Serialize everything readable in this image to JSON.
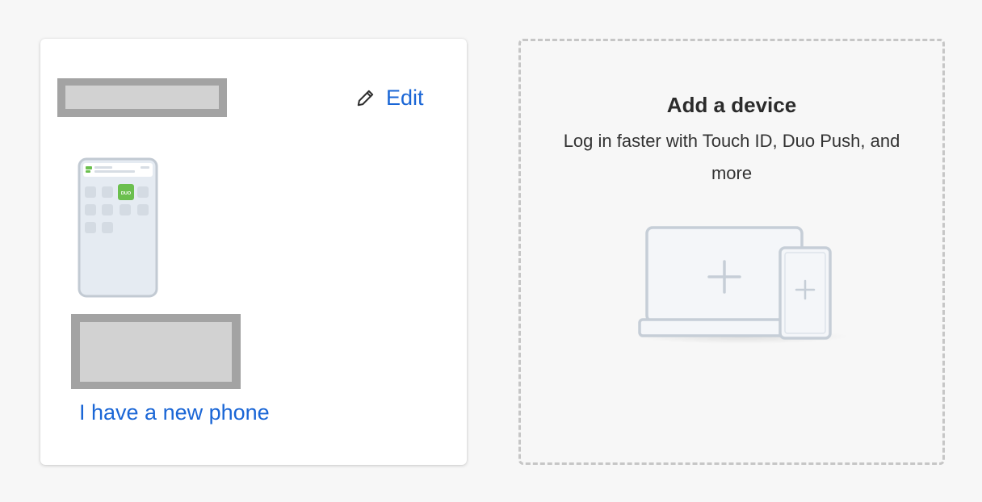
{
  "device_card": {
    "edit_label": "Edit",
    "new_phone_label": "I have a new phone",
    "app_badge_text": "DUO"
  },
  "add_device_card": {
    "title": "Add a device",
    "subtitle": "Log in faster with Touch ID, Duo Push, and more"
  },
  "colors": {
    "link": "#1a66d6",
    "duo_green": "#6bbf4e",
    "redaction_outer": "#a3a3a3",
    "redaction_inner": "#d2d2d2",
    "background": "#f7f7f7"
  },
  "icons": {
    "edit": "pencil-icon",
    "add": "plus-icon"
  }
}
